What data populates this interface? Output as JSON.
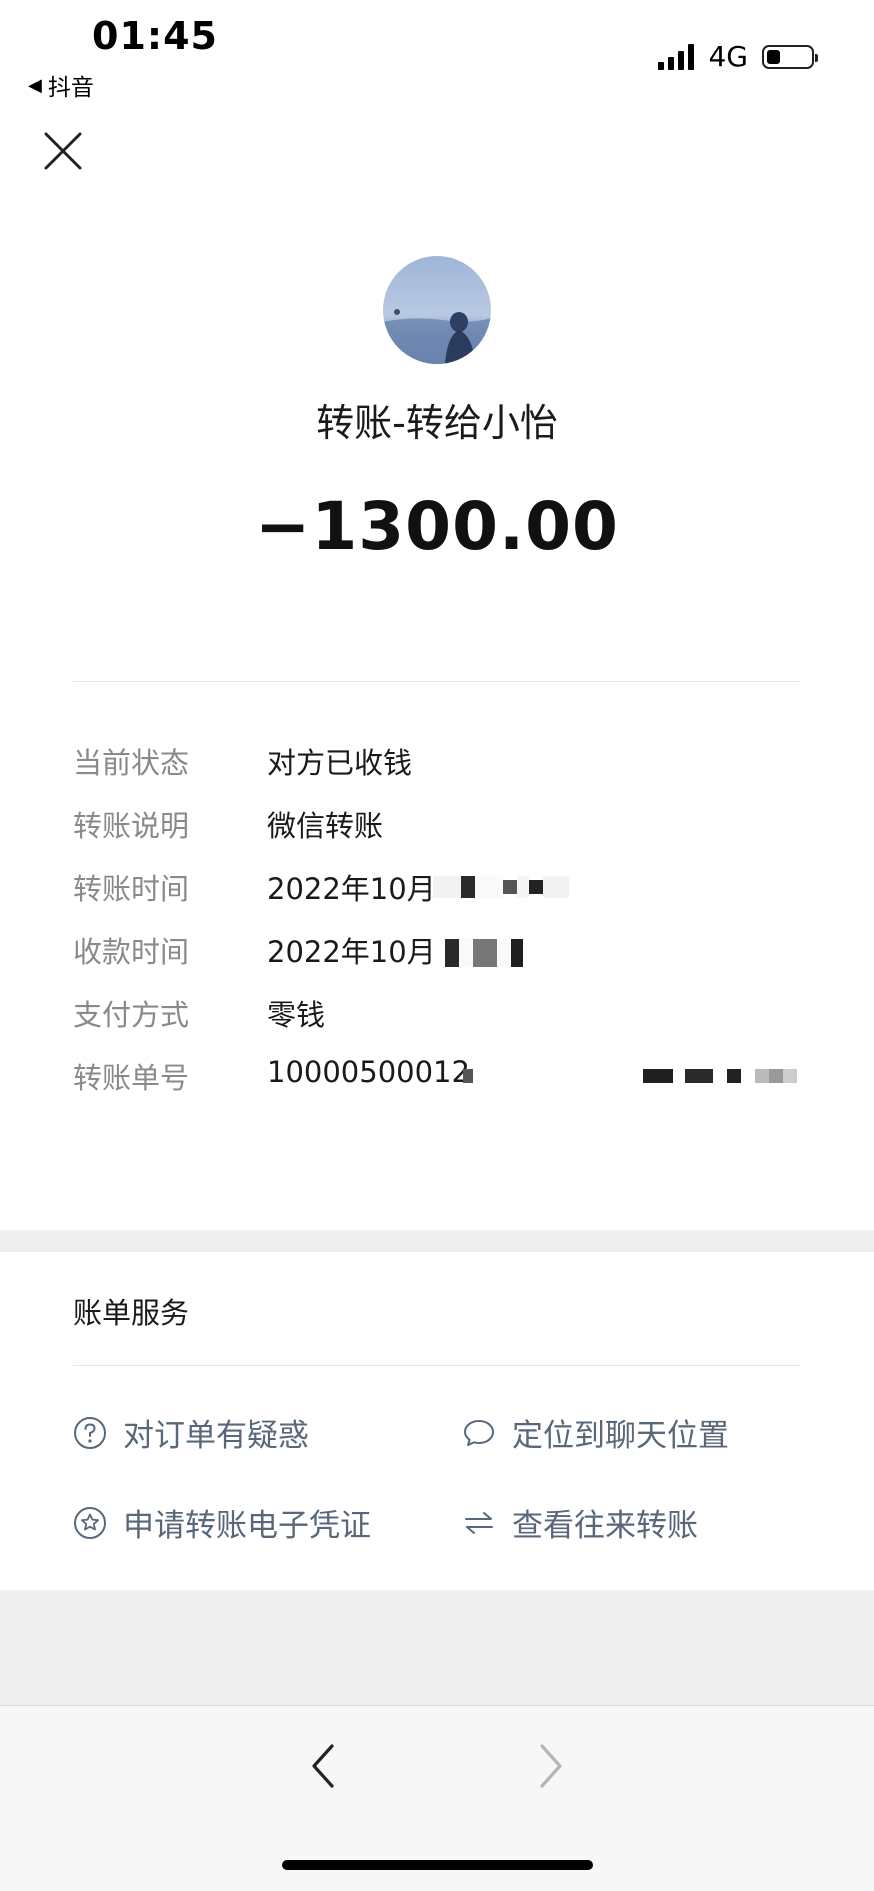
{
  "status_bar": {
    "time": "01:45",
    "back_app": "抖音",
    "network": "4G",
    "battery_level": 0.3
  },
  "header": {
    "title": "转账-转给小怡",
    "amount": "−1300.00"
  },
  "details": [
    {
      "label": "当前状态",
      "value": "对方已收钱"
    },
    {
      "label": "转账说明",
      "value": "微信转账"
    },
    {
      "label": "转账时间",
      "value": "2022年10月"
    },
    {
      "label": "收款时间",
      "value": "2022年10月"
    },
    {
      "label": "支付方式",
      "value": "零钱"
    },
    {
      "label": "转账单号",
      "value": "10000500012"
    }
  ],
  "services": {
    "title": "账单服务",
    "items": [
      {
        "label": "对订单有疑惑",
        "icon": "question-circle-icon"
      },
      {
        "label": "定位到聊天位置",
        "icon": "chat-bubble-icon"
      },
      {
        "label": "申请转账电子凭证",
        "icon": "star-circle-icon"
      },
      {
        "label": "查看往来转账",
        "icon": "swap-arrows-icon"
      }
    ]
  },
  "colors": {
    "label_gray": "#8a8a8a",
    "service_text": "#586779",
    "separator_bg": "#efefef"
  }
}
